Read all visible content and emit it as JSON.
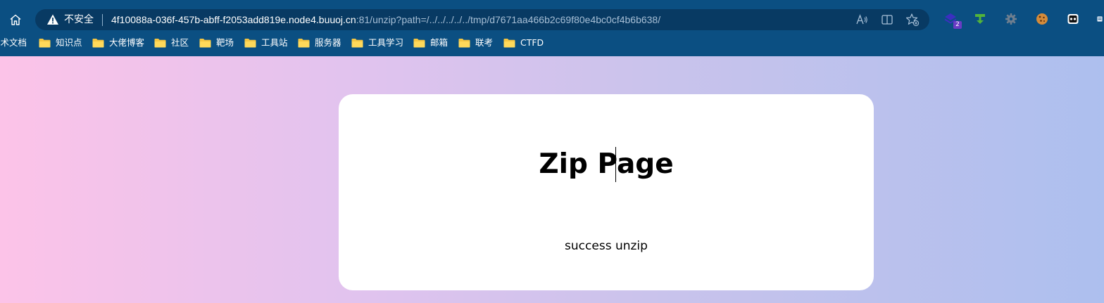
{
  "browser": {
    "security_label": "不安全",
    "url": {
      "host": "4f10088a-036f-457b-abff-f2053add819e.node4.buuoj.cn",
      "rest": ":81/unzip?path=/../../../../../tmp/d7671aa466b2c69f80e4bc0cf4b6b638/"
    },
    "extensions": [
      {
        "icon": "stack-extension-icon",
        "badge": "2"
      },
      {
        "icon": "green-download-extension-icon"
      },
      {
        "icon": "gear-extension-icon"
      },
      {
        "icon": "cookie-extension-icon"
      },
      {
        "icon": "robot-extension-icon"
      }
    ],
    "bookmarks": [
      {
        "label": "技术文档"
      },
      {
        "label": "知识点"
      },
      {
        "label": "大佬博客"
      },
      {
        "label": "社区"
      },
      {
        "label": "靶场"
      },
      {
        "label": "工具站"
      },
      {
        "label": "服务器"
      },
      {
        "label": "工具学习"
      },
      {
        "label": "邮箱"
      },
      {
        "label": "联考"
      },
      {
        "label": "CTFD"
      }
    ]
  },
  "page": {
    "title": "Zip Page",
    "message": "success unzip"
  },
  "colors": {
    "chrome": "#0b4f82",
    "address_bar": "#083a63",
    "gradient_left": "#fcc3e8",
    "gradient_right": "#adbfee",
    "card": "#ffffff"
  }
}
